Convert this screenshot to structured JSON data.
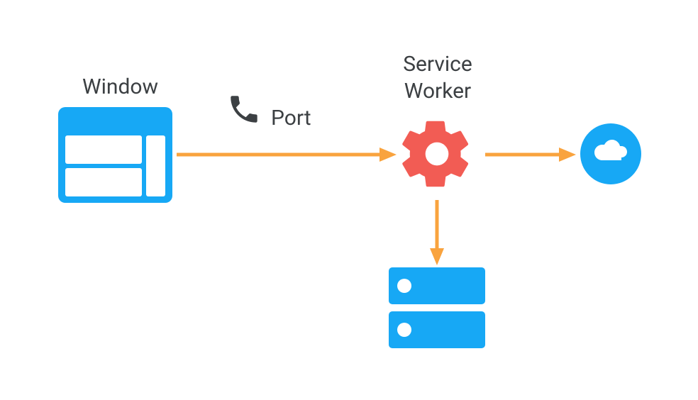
{
  "diagram": {
    "nodes": {
      "window": {
        "label": "Window"
      },
      "service_worker": {
        "label_line1": "Service",
        "label_line2": "Worker"
      },
      "port": {
        "label": "Port"
      },
      "cache": {
        "label": ""
      },
      "cloud": {
        "label": ""
      }
    },
    "edges": [
      {
        "from": "window",
        "to": "service_worker",
        "label": "Port"
      },
      {
        "from": "service_worker",
        "to": "cloud"
      },
      {
        "from": "service_worker",
        "to": "cache"
      }
    ],
    "colors": {
      "primary": "#17A8F5",
      "accent": "#F25C54",
      "arrow": "#F9A33E",
      "text": "#3c4043",
      "dark": "#3c4043"
    }
  }
}
